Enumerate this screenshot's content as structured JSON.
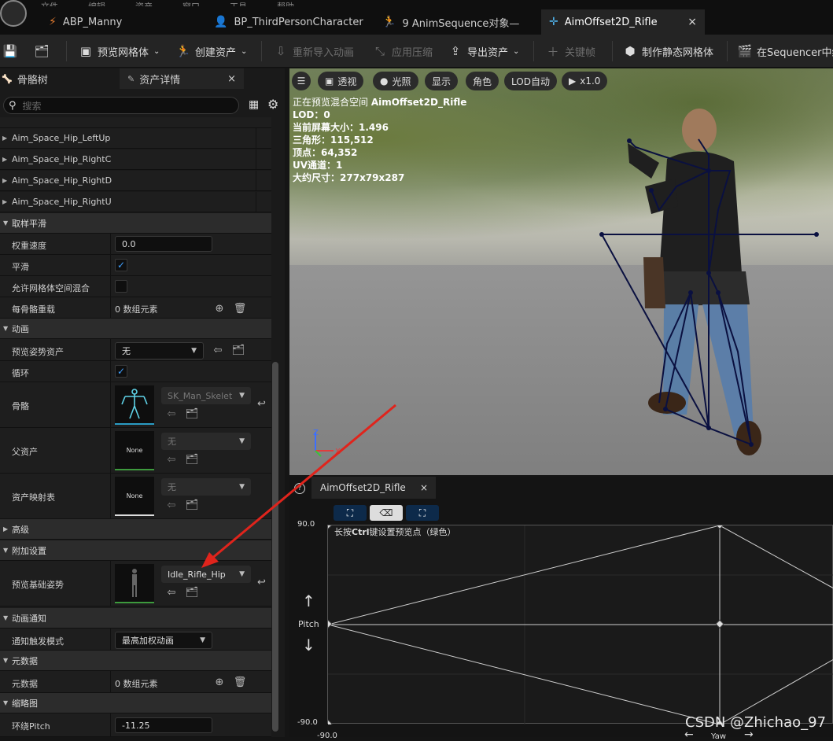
{
  "menu": [
    "文件",
    "编辑",
    "资产",
    "窗口",
    "工具",
    "帮助"
  ],
  "tabs": [
    {
      "label": "ABP_Manny",
      "icon": "anim-blueprint-icon"
    },
    {
      "label": "BP_ThirdPersonCharacter",
      "icon": "person-icon"
    },
    {
      "label": "9 AnimSequence对象—",
      "icon": "anim-sequence-icon"
    },
    {
      "label": "AimOffset2D_Rifle",
      "icon": "crosshair-icon",
      "active": true,
      "close": "×"
    }
  ],
  "toolbar": {
    "preview_mesh": "预览网格体",
    "create_asset": "创建资产",
    "reimport": "重新导入动画",
    "apply_compress": "应用压缩",
    "export_asset": "导出资产",
    "keyframe": "关键帧",
    "make_static_mesh": "制作静态网格体",
    "sequencer": "在Sequencer中编"
  },
  "left_panel": {
    "tab_skeleton": "骨骼树",
    "tab_details": "资产详情",
    "close": "×",
    "search_placeholder": "搜索",
    "truncated_rows": [
      "Aim_Space_Hip_LeftUp",
      "Aim_Space_Hip_RightC",
      "Aim_Space_Hip_RightD",
      "Aim_Space_Hip_RightU"
    ],
    "sections": {
      "sampling": "取样平滑",
      "animation": "动画",
      "advanced": "高级",
      "additive": "附加设置",
      "notify": "动画通知",
      "metadata": "元数据",
      "thumbnail": "缩略图"
    },
    "props": {
      "weight_speed_label": "权重速度",
      "weight_speed_value": "0.0",
      "smoothing_label": "平滑",
      "allow_mesh_space_label": "允许网格体空间混合",
      "per_bone_label": "每骨骼重载",
      "per_bone_value": "0 数组元素",
      "preview_pose_label": "预览姿势资产",
      "preview_pose_value": "无",
      "loop_label": "循环",
      "skeleton_label": "骨骼",
      "skeleton_value": "SK_Man_Skelet",
      "parent_label": "父资产",
      "parent_value": "无",
      "parent_thumb": "None",
      "asset_map_label": "资产映射表",
      "asset_map_value": "无",
      "asset_map_thumb": "None",
      "preview_base_label": "预览基础姿势",
      "preview_base_value": "Idle_Rifle_Hip",
      "notify_mode_label": "通知触发模式",
      "notify_mode_value": "最高加权动画",
      "metadata_label": "元数据",
      "metadata_value": "0 数组元素",
      "orbit_pitch_label": "环绕Pitch",
      "orbit_pitch_value": "-11.25"
    }
  },
  "viewport": {
    "btn_perspective": "透视",
    "btn_lit": "光照",
    "btn_show": "显示",
    "btn_character": "角色",
    "btn_lod": "LOD自动",
    "btn_speed": "x1.0",
    "stats": [
      {
        "label": "正在预览混合空间 ",
        "value": "AimOffset2D_Rifle"
      },
      {
        "label": "LOD：",
        "value": "0"
      },
      {
        "label": "当前屏幕大小：",
        "value": "1.496"
      },
      {
        "label": "三角形：",
        "value": "115,512"
      },
      {
        "label": "顶点：",
        "value": "64,352"
      },
      {
        "label": "UV通道：",
        "value": "1"
      },
      {
        "label": "大约尺寸：",
        "value": "277x79x287"
      }
    ],
    "axis_z": "Z",
    "axis_x": "X"
  },
  "blendspace": {
    "tab": "AimOffset2D_Rifle",
    "close": "×",
    "hint_prefix": "长按",
    "hint_key": "Ctrl",
    "hint_suffix": "键设置预览点（绿色）",
    "y_max": "90.0",
    "y_min": "-90.0",
    "y_axis": "Pitch",
    "x_min": "-90.0",
    "x_axis": "Yaw"
  },
  "watermark": "CSDN @Zhichao_97"
}
